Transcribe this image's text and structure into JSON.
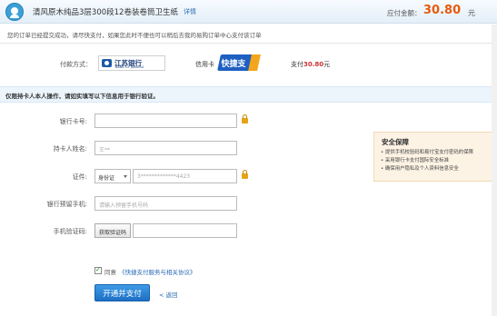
{
  "header": {
    "product_title": "清风原木纯品3层300段12卷装卷筒卫生纸",
    "detail_link": "详情",
    "amount_label": "应付金额：",
    "amount_value": "30.80",
    "amount_unit": "元"
  },
  "notice": "您的订单已经提交成功，请尽快支付，如果您此时不便也可以稍后去我的易购订单中心支付该订单",
  "payment": {
    "method_label": "付款方式：",
    "bank_name_cn": "江苏银行",
    "bank_name_en": "BANK OF JIANGSU",
    "card_type": "信用卡",
    "quickpay_logo": "快捷支付",
    "pay_prefix": "支付",
    "pay_amount": "30.80",
    "pay_unit": "元"
  },
  "tip": "仅限持卡人本人操作，请如实填写以下信息用于银行验证。",
  "form": {
    "card_no_label": "银行卡号:",
    "card_no_value": "",
    "holder_label": "持卡人姓名:",
    "holder_value": "王**",
    "id_label": "证件:",
    "id_type": "身份证",
    "id_value": "3*************4423",
    "phone_label": "银行预留手机:",
    "phone_placeholder": "请输入预留手机号码",
    "sms_label": "手机验证码:",
    "sms_button": "获取验证码",
    "sms_value": ""
  },
  "safety": {
    "title": "安全保障",
    "items": [
      "提供手机校验码和易付宝支付密码的保障",
      "采用银行卡支付国际安全标准",
      "确保用户隐私及个人资料信息安全"
    ]
  },
  "agreement": {
    "agree_text": "同意",
    "link_text": "《快捷支付服务与相关协议》",
    "checked": true
  },
  "actions": {
    "submit": "开通并支付",
    "back": "< 返回"
  },
  "colors": {
    "accent": "#1d6fc4",
    "amount": "#e85a0c",
    "tip_bg": "#ecf5fc",
    "safety_bg": "#fdf3e4"
  }
}
